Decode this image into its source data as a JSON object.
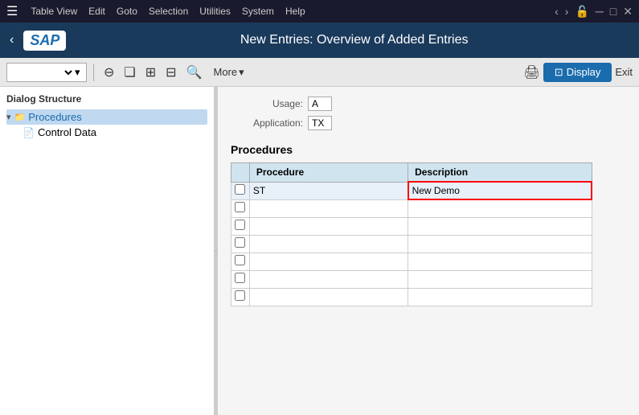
{
  "menuBar": {
    "hamburger": "☰",
    "items": [
      {
        "label": "Table View"
      },
      {
        "label": "Edit"
      },
      {
        "label": "Goto"
      },
      {
        "label": "Selection"
      },
      {
        "label": "Utilities"
      },
      {
        "label": "System"
      },
      {
        "label": "Help"
      }
    ],
    "navLeft": "‹",
    "navLock": "🔓"
  },
  "titleBar": {
    "back": "‹",
    "sapLogo": "SAP",
    "title": "New Entries: Overview of Added Entries"
  },
  "toolbar": {
    "dropdown": "",
    "more": "More",
    "display": "Display",
    "exit": "Exit"
  },
  "sidebar": {
    "structureTitle": "Dialog Structure",
    "items": [
      {
        "label": "Procedures",
        "selected": true,
        "expanded": true
      },
      {
        "label": "Control Data",
        "child": true
      }
    ]
  },
  "form": {
    "usageLabel": "Usage:",
    "usageValue": "A",
    "applicationLabel": "Application:",
    "applicationValue": "TX"
  },
  "proceduresSection": {
    "title": "Procedures",
    "tableHeaders": [
      "Procedure",
      "Description"
    ],
    "rows": [
      {
        "checkbox": false,
        "procedure": "ST",
        "description": "New Demo",
        "highlight": true
      },
      {
        "checkbox": false,
        "procedure": "",
        "description": "",
        "highlight": false
      },
      {
        "checkbox": false,
        "procedure": "",
        "description": "",
        "highlight": false
      },
      {
        "checkbox": false,
        "procedure": "",
        "description": "",
        "highlight": false
      },
      {
        "checkbox": false,
        "procedure": "",
        "description": "",
        "highlight": false
      },
      {
        "checkbox": false,
        "procedure": "",
        "description": "",
        "highlight": false
      },
      {
        "checkbox": false,
        "procedure": "",
        "description": "",
        "highlight": false
      }
    ]
  }
}
